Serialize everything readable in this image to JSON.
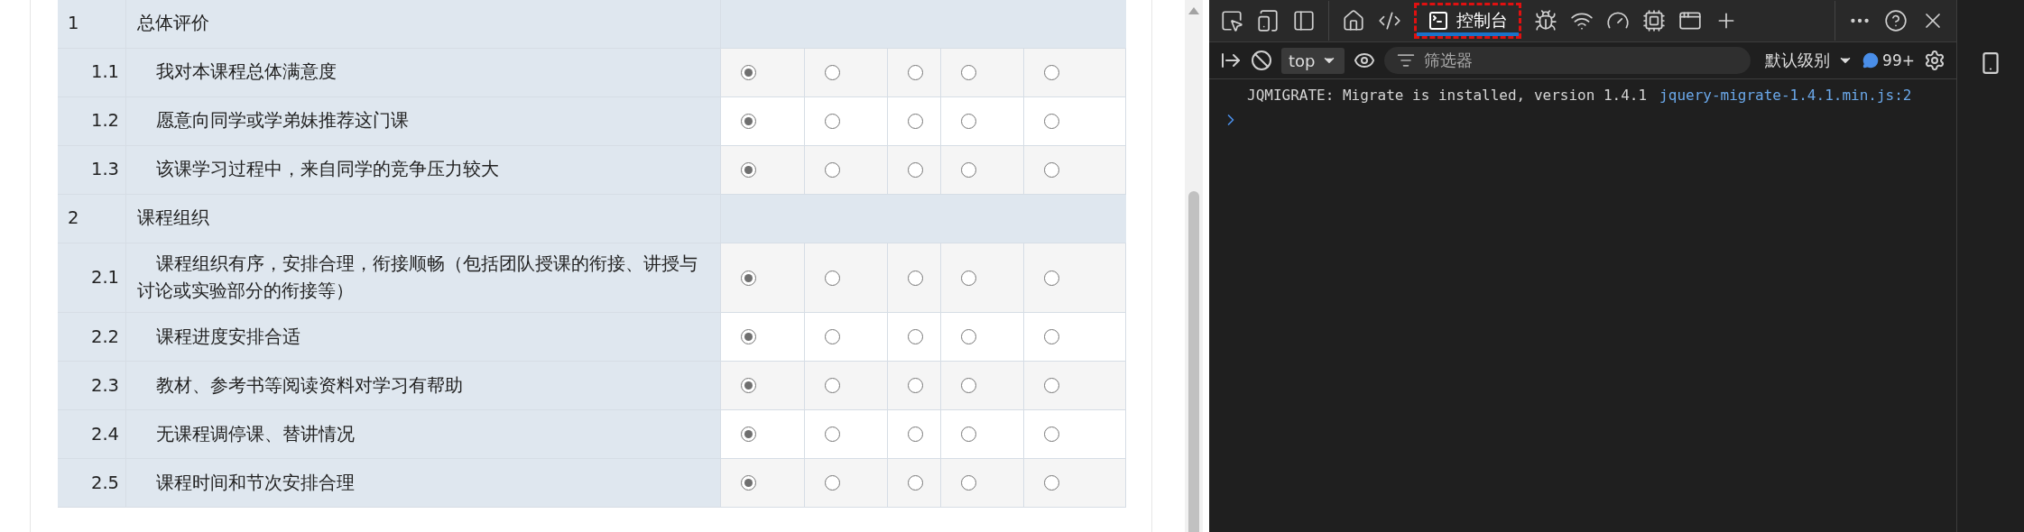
{
  "survey": {
    "rows": [
      {
        "kind": "section",
        "number": "1",
        "text": "总体评价"
      },
      {
        "kind": "item",
        "number": "1.1",
        "text": "我对本课程总体满意度",
        "options": [
          {
            "selected": true
          },
          {
            "selected": false
          },
          {
            "selected": false
          },
          {
            "selected": false
          },
          {
            "selected": false
          }
        ]
      },
      {
        "kind": "item",
        "number": "1.2",
        "text": "愿意向同学或学弟妹推荐这门课",
        "options": [
          {
            "selected": true
          },
          {
            "selected": false
          },
          {
            "selected": false
          },
          {
            "selected": false
          },
          {
            "selected": false
          }
        ]
      },
      {
        "kind": "item",
        "number": "1.3",
        "text": "该课学习过程中，来自同学的竞争压力较大",
        "options": [
          {
            "selected": true
          },
          {
            "selected": false
          },
          {
            "selected": false
          },
          {
            "selected": false
          },
          {
            "selected": false
          }
        ]
      },
      {
        "kind": "section",
        "number": "2",
        "text": "课程组织"
      },
      {
        "kind": "item",
        "number": "2.1",
        "text": "课程组织有序，安排合理，衔接顺畅（包括团队授课的衔接、讲授与讨论或实验部分的衔接等）",
        "options": [
          {
            "selected": true
          },
          {
            "selected": false
          },
          {
            "selected": false
          },
          {
            "selected": false
          },
          {
            "selected": false
          }
        ]
      },
      {
        "kind": "item",
        "number": "2.2",
        "text": "课程进度安排合适",
        "options": [
          {
            "selected": true
          },
          {
            "selected": false
          },
          {
            "selected": false
          },
          {
            "selected": false
          },
          {
            "selected": false
          }
        ]
      },
      {
        "kind": "item",
        "number": "2.3",
        "text": "教材、参考书等阅读资料对学习有帮助",
        "options": [
          {
            "selected": true
          },
          {
            "selected": false
          },
          {
            "selected": false
          },
          {
            "selected": false
          },
          {
            "selected": false
          }
        ]
      },
      {
        "kind": "item",
        "number": "2.4",
        "text": "无课程调停课、替讲情况",
        "options": [
          {
            "selected": true
          },
          {
            "selected": false
          },
          {
            "selected": false
          },
          {
            "selected": false
          },
          {
            "selected": false
          }
        ]
      },
      {
        "kind": "item",
        "number": "2.5",
        "text": "课程时间和节次安排合理",
        "options": [
          {
            "selected": true
          },
          {
            "selected": false
          },
          {
            "selected": false
          },
          {
            "selected": false
          },
          {
            "selected": false
          }
        ]
      }
    ]
  },
  "devtools": {
    "tabs": [
      {
        "kind": "inspect"
      },
      {
        "kind": "device"
      },
      {
        "kind": "dock"
      },
      {
        "kind": "home"
      },
      {
        "kind": "elements"
      },
      {
        "kind": "console",
        "label": "控制台",
        "selected": true
      },
      {
        "kind": "bug"
      },
      {
        "kind": "network"
      },
      {
        "kind": "performance"
      },
      {
        "kind": "memory"
      },
      {
        "kind": "application"
      },
      {
        "kind": "add"
      }
    ],
    "context": "top",
    "filter": {
      "placeholder": "筛选器"
    },
    "level": "默认级别",
    "message_count": "99+",
    "console": [
      {
        "text": "JQMIGRATE: Migrate is installed, version 1.4.1",
        "source": "jquery-migrate-1.4.1.min.js:2"
      }
    ]
  }
}
